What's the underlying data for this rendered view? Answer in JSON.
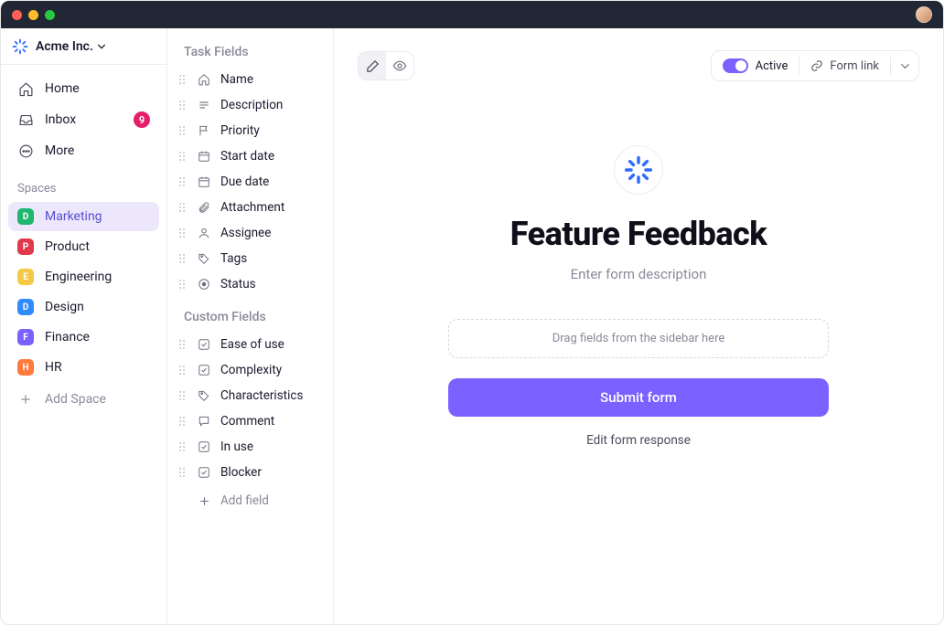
{
  "workspace": {
    "name": "Acme Inc."
  },
  "nav": {
    "home": "Home",
    "inbox": "Inbox",
    "inbox_badge": "9",
    "more": "More"
  },
  "spaces": {
    "header": "Spaces",
    "items": [
      {
        "letter": "D",
        "label": "Marketing",
        "color": "#1fb66e",
        "active": true
      },
      {
        "letter": "P",
        "label": "Product",
        "color": "#e03a4a"
      },
      {
        "letter": "E",
        "label": "Engineering",
        "color": "#f5c945"
      },
      {
        "letter": "D",
        "label": "Design",
        "color": "#2f8bff"
      },
      {
        "letter": "F",
        "label": "Finance",
        "color": "#7b61ff"
      },
      {
        "letter": "H",
        "label": "HR",
        "color": "#ff7a3d"
      }
    ],
    "add": "Add Space"
  },
  "fields": {
    "task_header": "Task Fields",
    "task_items": [
      {
        "icon": "home",
        "label": "Name"
      },
      {
        "icon": "text",
        "label": "Description"
      },
      {
        "icon": "flag",
        "label": "Priority"
      },
      {
        "icon": "calendar",
        "label": "Start date"
      },
      {
        "icon": "calendar",
        "label": "Due date"
      },
      {
        "icon": "clip",
        "label": "Attachment"
      },
      {
        "icon": "user",
        "label": "Assignee"
      },
      {
        "icon": "tag",
        "label": "Tags"
      },
      {
        "icon": "status",
        "label": "Status"
      }
    ],
    "custom_header": "Custom Fields",
    "custom_items": [
      {
        "icon": "check",
        "label": "Ease of use"
      },
      {
        "icon": "check",
        "label": "Complexity"
      },
      {
        "icon": "tag",
        "label": "Characteristics"
      },
      {
        "icon": "comment",
        "label": "Comment"
      },
      {
        "icon": "check",
        "label": "In use"
      },
      {
        "icon": "check",
        "label": "Blocker"
      }
    ],
    "add": "Add field"
  },
  "toolbar": {
    "active_label": "Active",
    "formlink_label": "Form link"
  },
  "form": {
    "title": "Feature Feedback",
    "description_placeholder": "Enter form description",
    "drop_hint": "Drag fields from the sidebar here",
    "submit": "Submit form",
    "edit_response": "Edit form response"
  }
}
